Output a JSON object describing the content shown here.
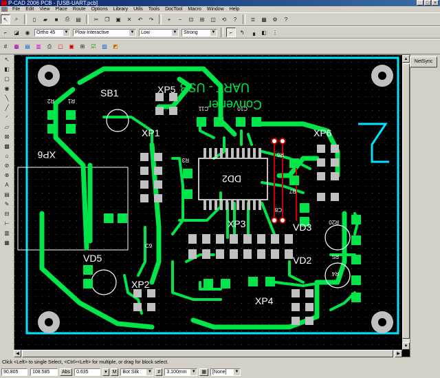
{
  "window": {
    "title": "P-CAD 2006 PCB - [USB-UART.pcb]"
  },
  "menu": [
    "File",
    "Edit",
    "View",
    "Place",
    "Route",
    "Options",
    "Library",
    "Utils",
    "Tools",
    "DocTool",
    "Macro",
    "Window",
    "Help"
  ],
  "toolbar2": {
    "route_mode": "Ortho 45",
    "router": "Plow Interactive",
    "mode1": "Low",
    "mode2": "Strong"
  },
  "netsync": "NetSync",
  "board": {
    "silk_text": [
      "UART - USB",
      "Converter"
    ],
    "labels": [
      "XP5",
      "SB1",
      "XP1",
      "XP6",
      "XP3",
      "XP2",
      "XP4",
      "VD3",
      "VD2",
      "VD5",
      "DD2",
      "XP6",
      "R2",
      "R1",
      "C11",
      "C10",
      "R3",
      "R6",
      "R7",
      "C8",
      "R20",
      "R5",
      "R4",
      "C9"
    ],
    "colors": {
      "copper": "#00e64a",
      "board": "#000000",
      "edge": "#00e5ff",
      "pad": "#c0c0c0",
      "via_ring": "#c00000"
    }
  },
  "status": {
    "hint": "Click <Left> to single Select, <Ctrl><Left> for multiple, or drag for block select."
  },
  "bottom": {
    "x": "90.805",
    "y": "108.585",
    "abs": "Abs",
    "width": "0.635",
    "layer": "Bot Silk",
    "grid": "3.100mm",
    "none": "[None]"
  }
}
